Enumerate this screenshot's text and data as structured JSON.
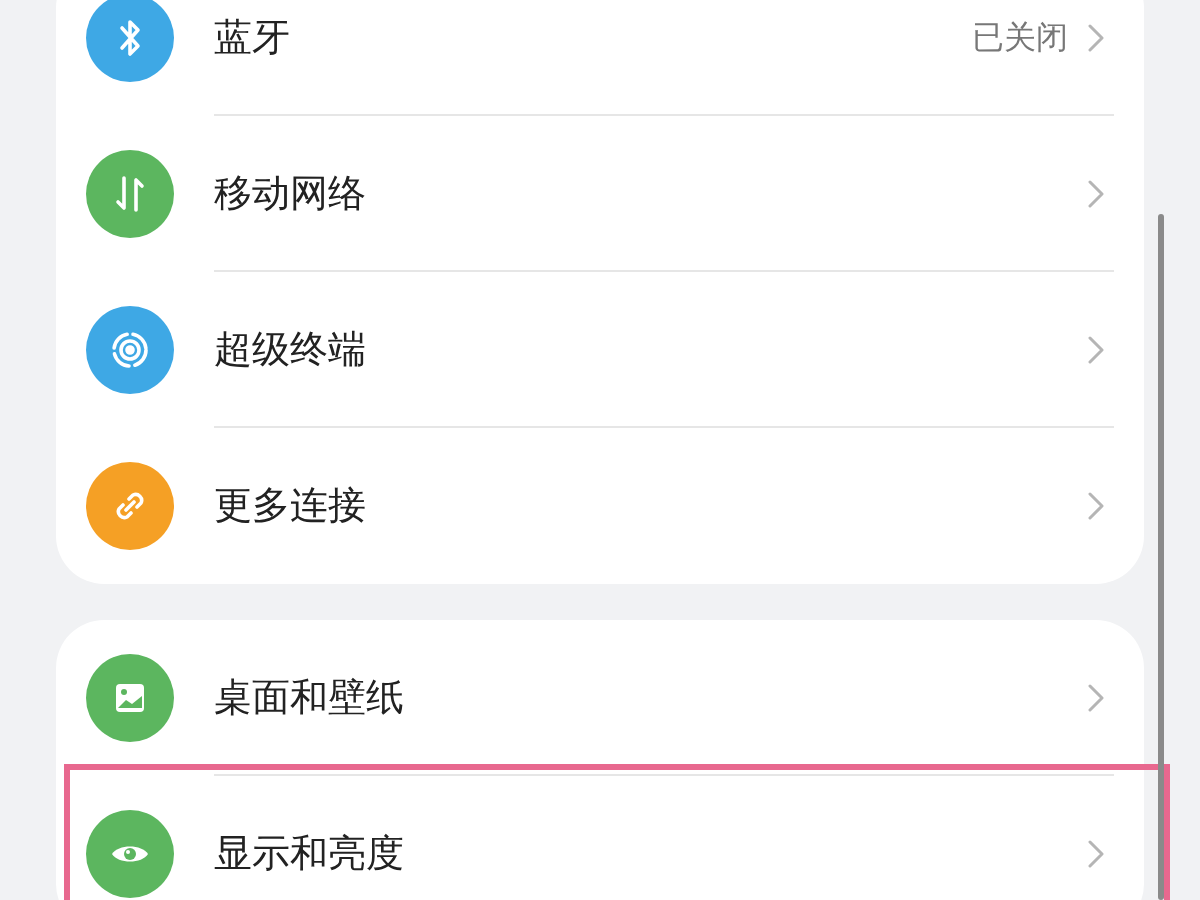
{
  "groups": [
    {
      "items": [
        {
          "label": "蓝牙",
          "value": "已关闭",
          "color": "#3ea8e5",
          "highlighted": false
        },
        {
          "label": "移动网络",
          "color": "#5cb65f",
          "highlighted": false
        },
        {
          "label": "超级终端",
          "color": "#3ea8e5",
          "highlighted": false
        },
        {
          "label": "更多连接",
          "color": "#f5a025",
          "highlighted": false
        }
      ]
    },
    {
      "items": [
        {
          "label": "桌面和壁纸",
          "color": "#5cb65f",
          "highlighted": false
        },
        {
          "label": "显示和亮度",
          "color": "#5cb65f",
          "highlighted": true
        }
      ]
    }
  ]
}
